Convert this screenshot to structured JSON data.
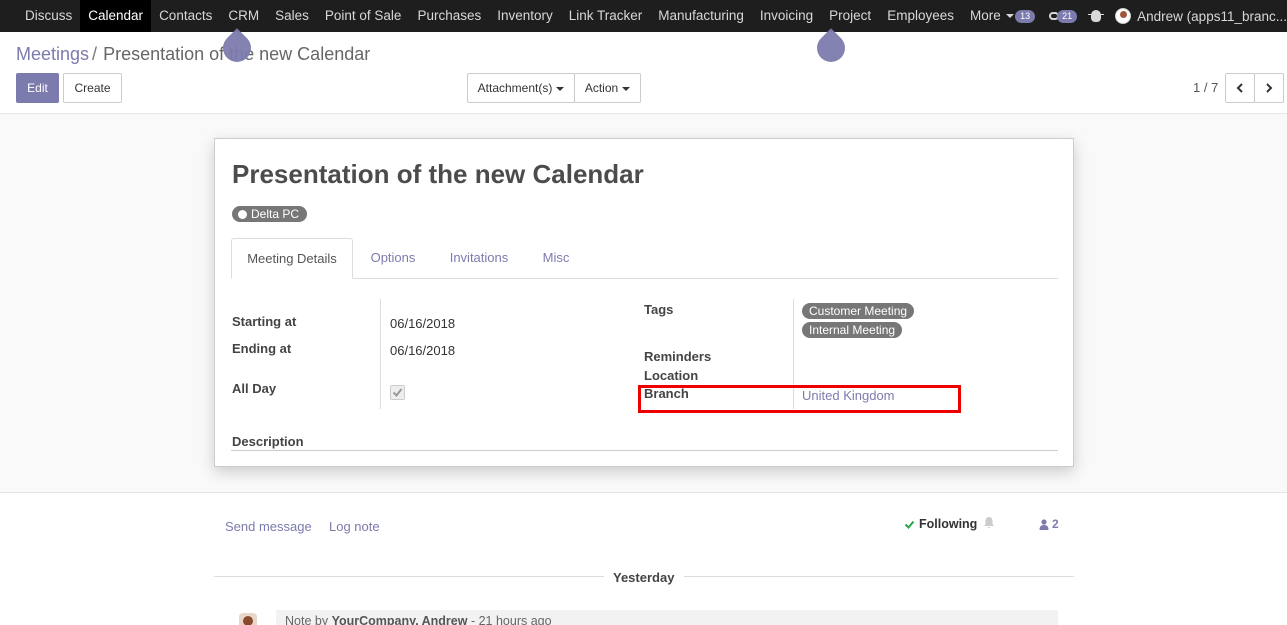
{
  "topnav": {
    "menu": [
      "Discuss",
      "Calendar",
      "Contacts",
      "CRM",
      "Sales",
      "Point of Sale",
      "Purchases",
      "Inventory",
      "Link Tracker",
      "Manufacturing",
      "Invoicing",
      "Project",
      "Employees"
    ],
    "more_label": "More",
    "active": "Calendar",
    "activity_count": "13",
    "message_count": "21",
    "user": "Andrew (apps11_branc..."
  },
  "breadcrumb": {
    "parent": "Meetings",
    "separator": "/",
    "current": "Presentation of the new Calendar"
  },
  "toolbar": {
    "edit_label": "Edit",
    "create_label": "Create",
    "attachments_label": "Attachment(s)",
    "action_label": "Action",
    "pager": "1 / 7"
  },
  "form": {
    "title": "Presentation of the new Calendar",
    "partner_tag": "Delta PC",
    "tabs": [
      "Meeting Details",
      "Options",
      "Invitations",
      "Misc"
    ],
    "starting_at_label": "Starting at",
    "starting_at_value": "06/16/2018",
    "ending_at_label": "Ending at",
    "ending_at_value": "06/16/2018",
    "all_day_label": "All Day",
    "all_day_checked": true,
    "tags_label": "Tags",
    "tags": [
      "Customer Meeting",
      "Internal Meeting"
    ],
    "reminders_label": "Reminders",
    "location_label": "Location",
    "branch_label": "Branch",
    "branch_value": "United Kingdom",
    "description_label": "Description"
  },
  "chatter": {
    "send_message": "Send message",
    "log_note": "Log note",
    "following": "Following",
    "followers_count": "2",
    "date_separator": "Yesterday",
    "note_prefix": "Note by",
    "note_author": "YourCompany, Andrew",
    "note_time": "- 21 hours ago"
  },
  "colors": {
    "accent": "#7c7bad",
    "nav_bg": "#1e1e1e",
    "highlight": "#e00000"
  }
}
